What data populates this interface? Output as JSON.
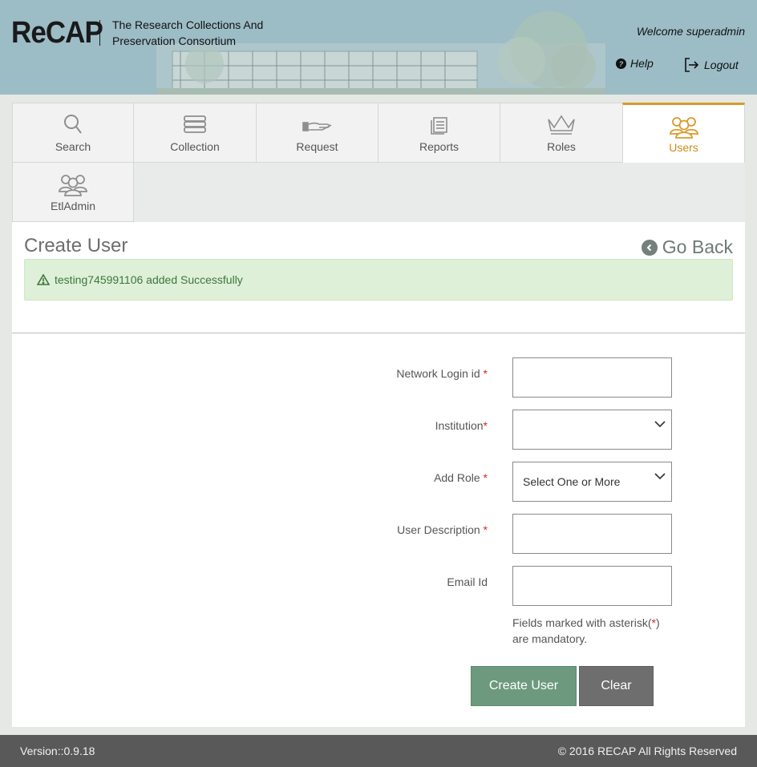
{
  "header": {
    "logo": "ReCAP",
    "consortium": "The Research Collections And Preservation Consortium",
    "welcome": "Welcome superadmin",
    "help": "Help",
    "logout": "Logout"
  },
  "nav": {
    "tabs": [
      {
        "label": "Search",
        "icon": "search-icon"
      },
      {
        "label": "Collection",
        "icon": "books-icon"
      },
      {
        "label": "Request",
        "icon": "hand-book-icon"
      },
      {
        "label": "Reports",
        "icon": "report-icon"
      },
      {
        "label": "Roles",
        "icon": "crown-icon"
      },
      {
        "label": "Users",
        "icon": "users-icon",
        "active": true
      },
      {
        "label": "EtlAdmin",
        "icon": "users-icon"
      }
    ]
  },
  "page": {
    "title": "Create User",
    "go_back": "Go Back",
    "alert": "testing745991106 added Successfully"
  },
  "form": {
    "network_login": {
      "label": "Network Login id",
      "required": "*",
      "value": ""
    },
    "institution": {
      "label": "Institution",
      "required": "*",
      "value": ""
    },
    "add_role": {
      "label": "Add Role",
      "required": "*",
      "value": "Select One or More"
    },
    "user_description": {
      "label": "User Description",
      "required": "*",
      "value": ""
    },
    "email": {
      "label": "Email Id",
      "value": ""
    },
    "hint_before": "Fields marked with asterisk(",
    "hint_star": "*",
    "hint_after": ") are mandatory.",
    "create_button": "Create User",
    "clear_button": "Clear"
  },
  "footer": {
    "version": "Version::0.9.18",
    "copyright": "© 2016 RECAP All Rights Reserved"
  },
  "colors": {
    "header_bg": "#9cbcc6",
    "active_tab": "#d99a2b",
    "success_bg": "#dff0d8",
    "success_text": "#3c763d",
    "create_button": "#6d9a7e",
    "clear_button": "#6e6e6e",
    "footer_bg": "#595959"
  }
}
